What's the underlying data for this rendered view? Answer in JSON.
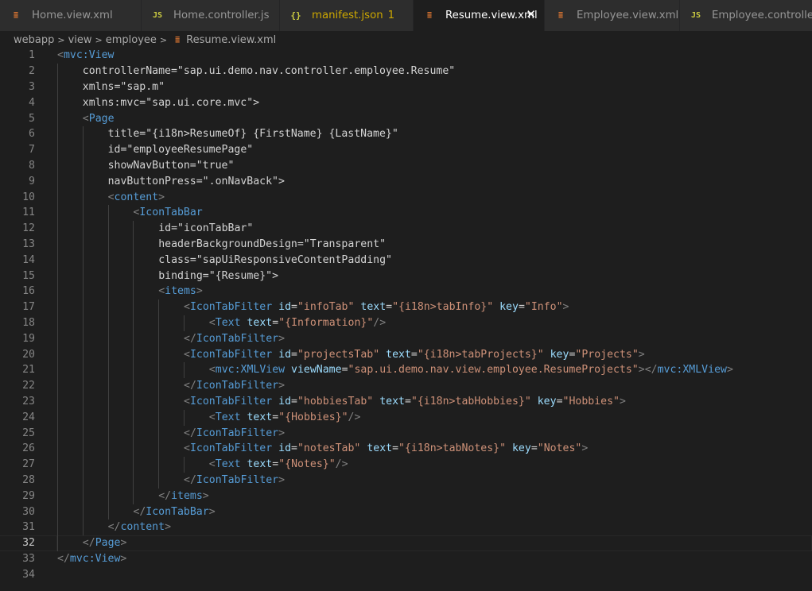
{
  "tabs": [
    {
      "label": "Home.view.xml",
      "icon": "xml-file-icon",
      "icon_glyph": "≣",
      "type": "xml",
      "active": false
    },
    {
      "label": "Home.controller.js",
      "icon": "js-file-icon",
      "icon_glyph": "JS",
      "type": "js",
      "active": false
    },
    {
      "label": "manifest.json",
      "badge": "1",
      "icon": "json-file-icon",
      "icon_glyph": "{}",
      "type": "json",
      "active": false
    },
    {
      "label": "Resume.view.xml",
      "icon": "xml-file-icon",
      "icon_glyph": "≣",
      "type": "xml",
      "active": true,
      "close": "✕"
    },
    {
      "label": "Employee.view.xml",
      "icon": "xml-file-icon",
      "icon_glyph": "≣",
      "type": "xml",
      "active": false
    },
    {
      "label": "Employee.controller.js",
      "icon": "js-file-icon",
      "icon_glyph": "JS",
      "type": "js",
      "active": false
    }
  ],
  "breadcrumb": {
    "items": [
      "webapp",
      "view",
      "employee"
    ],
    "separator": ">",
    "file": "Resume.view.xml",
    "file_icon_glyph": "≣"
  },
  "editor": {
    "current_line": 32,
    "lines": [
      {
        "n": "1",
        "indent": 0,
        "code": "<mvc:View"
      },
      {
        "n": "2",
        "indent": 1,
        "code": "controllerName=\"sap.ui.demo.nav.controller.employee.Resume\""
      },
      {
        "n": "3",
        "indent": 1,
        "code": "xmlns=\"sap.m\""
      },
      {
        "n": "4",
        "indent": 1,
        "code": "xmlns:mvc=\"sap.ui.core.mvc\">"
      },
      {
        "n": "5",
        "indent": 1,
        "code": "<Page"
      },
      {
        "n": "6",
        "indent": 2,
        "code": "title=\"{i18n>ResumeOf} {FirstName} {LastName}\""
      },
      {
        "n": "7",
        "indent": 2,
        "code": "id=\"employeeResumePage\""
      },
      {
        "n": "8",
        "indent": 2,
        "code": "showNavButton=\"true\""
      },
      {
        "n": "9",
        "indent": 2,
        "code": "navButtonPress=\".onNavBack\">"
      },
      {
        "n": "10",
        "indent": 2,
        "code": "<content>"
      },
      {
        "n": "11",
        "indent": 3,
        "code": "<IconTabBar"
      },
      {
        "n": "12",
        "indent": 4,
        "code": "id=\"iconTabBar\""
      },
      {
        "n": "13",
        "indent": 4,
        "code": "headerBackgroundDesign=\"Transparent\""
      },
      {
        "n": "14",
        "indent": 4,
        "code": "class=\"sapUiResponsiveContentPadding\""
      },
      {
        "n": "15",
        "indent": 4,
        "code": "binding=\"{Resume}\">"
      },
      {
        "n": "16",
        "indent": 4,
        "code": "<items>"
      },
      {
        "n": "17",
        "indent": 5,
        "code": "<IconTabFilter id=\"infoTab\" text=\"{i18n>tabInfo}\" key=\"Info\">"
      },
      {
        "n": "18",
        "indent": 6,
        "code": "<Text text=\"{Information}\"/>"
      },
      {
        "n": "19",
        "indent": 5,
        "code": "</IconTabFilter>"
      },
      {
        "n": "20",
        "indent": 5,
        "code": "<IconTabFilter id=\"projectsTab\" text=\"{i18n>tabProjects}\" key=\"Projects\">"
      },
      {
        "n": "21",
        "indent": 6,
        "code": "<mvc:XMLView viewName=\"sap.ui.demo.nav.view.employee.ResumeProjects\"></mvc:XMLView>"
      },
      {
        "n": "22",
        "indent": 5,
        "code": "</IconTabFilter>"
      },
      {
        "n": "23",
        "indent": 5,
        "code": "<IconTabFilter id=\"hobbiesTab\" text=\"{i18n>tabHobbies}\" key=\"Hobbies\">"
      },
      {
        "n": "24",
        "indent": 6,
        "code": "<Text text=\"{Hobbies}\"/>"
      },
      {
        "n": "25",
        "indent": 5,
        "code": "</IconTabFilter>"
      },
      {
        "n": "26",
        "indent": 5,
        "code": "<IconTabFilter id=\"notesTab\" text=\"{i18n>tabNotes}\" key=\"Notes\">"
      },
      {
        "n": "27",
        "indent": 6,
        "code": "<Text text=\"{Notes}\"/>"
      },
      {
        "n": "28",
        "indent": 5,
        "code": "</IconTabFilter>"
      },
      {
        "n": "29",
        "indent": 4,
        "code": "</items>"
      },
      {
        "n": "30",
        "indent": 3,
        "code": "</IconTabBar>"
      },
      {
        "n": "31",
        "indent": 2,
        "code": "</content>"
      },
      {
        "n": "32",
        "indent": 1,
        "code": "</Page>"
      },
      {
        "n": "33",
        "indent": 0,
        "code": "</mvc:View>"
      },
      {
        "n": "34",
        "indent": 0,
        "code": ""
      }
    ]
  }
}
